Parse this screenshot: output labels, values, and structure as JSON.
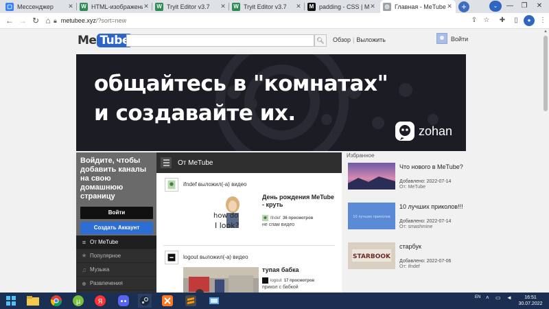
{
  "browser": {
    "tabs": [
      {
        "title": "Мессенджер",
        "favicon_color": "#3b82f6",
        "glyph": "▢"
      },
      {
        "title": "HTML-изображения",
        "favicon_color": "#2e8b57",
        "glyph": "W"
      },
      {
        "title": "Tryit Editor v3.7",
        "favicon_color": "#2e8b57",
        "glyph": "W"
      },
      {
        "title": "Tryit Editor v3.7",
        "favicon_color": "#2e8b57",
        "glyph": "W"
      },
      {
        "title": "padding - CSS | MDN",
        "favicon_color": "#111111",
        "glyph": "M"
      },
      {
        "title": "Главная - MeTube",
        "favicon_color": "#9aa0a6",
        "glyph": "◎",
        "active": true
      }
    ],
    "new_tab": "+",
    "url_host": "metubee.xyz",
    "url_path": "/?sort=new"
  },
  "site": {
    "logo_me": "Me",
    "logo_tube": "Tube",
    "search_placeholder": "",
    "search_icon": "search-icon",
    "link_browse": "Обзор",
    "link_upload": "Выложить",
    "signin": "Войти"
  },
  "banner": {
    "line1": "общайтесь в \"комнатах\"",
    "line2": "и создавайте их.",
    "brand": "zohan"
  },
  "sidebar": {
    "prompt": "Войдите, чтобы добавить каналы на свою домашнюю страницу",
    "login_button": "Войти",
    "create_button": "Создать Аккаунт",
    "items": [
      {
        "label": "От MeTube",
        "icon": "≡"
      },
      {
        "label": "Популярное",
        "icon": "★"
      },
      {
        "label": "Музыка",
        "icon": "♫"
      },
      {
        "label": "Развлечения",
        "icon": "☻"
      }
    ]
  },
  "center": {
    "title": "От MeTube",
    "activities": [
      {
        "who": "ifndef выложил(-а) видео",
        "video_title": "День рождения MeTube - круть",
        "author": "ifndef",
        "views": "36 просмотров",
        "desc": "не спам видео"
      },
      {
        "who": "logout выложил(-а) видео",
        "video_title": "тупая бабка",
        "author": "logout",
        "views": "17 просмотров",
        "desc": "прикол с бабкой"
      }
    ]
  },
  "favorites": {
    "title": "Избранное",
    "items": [
      {
        "title": "Что нового в MeTube?",
        "added": "Добавлено: 2022-07-14",
        "by_label": "От:",
        "by": "MeTube"
      },
      {
        "title": "10 лучших приколов!!!",
        "thumb_caption": "10 лучших приколов",
        "added": "Добавлено: 2022-07-14",
        "by_label": "От:",
        "by": "smashmine"
      },
      {
        "title": "старбук",
        "thumb_caption": "STARBOOK",
        "added": "Добавлено: 2022-07-06",
        "by_label": "От:",
        "by": "ifndef"
      }
    ]
  },
  "taskbar": {
    "lang": "EN",
    "time": "16:51",
    "date": "30.07.2022"
  },
  "colors": {
    "accent": "#2d64c8",
    "banner_bg": "#1c1c24",
    "sidebar_bg": "#2f2f2f",
    "taskbar_bg": "#1b2f53"
  }
}
